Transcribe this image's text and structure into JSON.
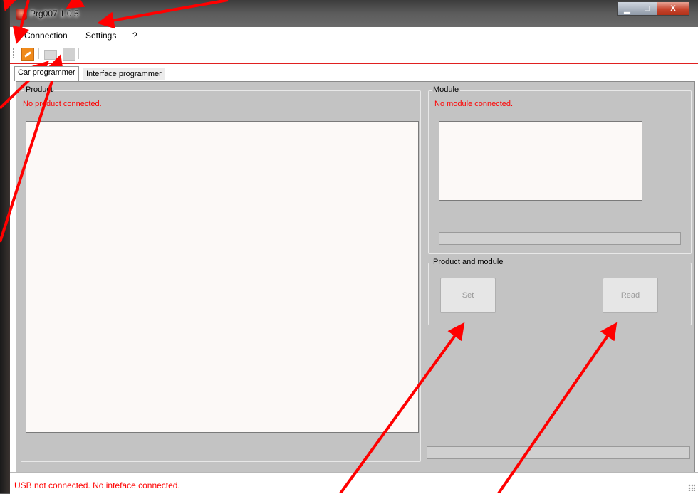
{
  "window": {
    "title": "Prg007  1.0.5",
    "controls": {
      "minimize": "▁",
      "maximize": "□",
      "close": "X"
    }
  },
  "menubar": {
    "items": [
      {
        "label": "Connection"
      },
      {
        "label": "Settings"
      },
      {
        "label": "?"
      }
    ]
  },
  "toolbar": {
    "buttons": [
      {
        "icon": "connect-icon",
        "enabled": true
      },
      {
        "icon": "open-folder-icon",
        "enabled": false
      },
      {
        "icon": "save-icon",
        "enabled": false
      }
    ]
  },
  "tabs": [
    {
      "label": "Car programmer",
      "active": true
    },
    {
      "label": "Interface programmer",
      "active": false
    }
  ],
  "product": {
    "group_label": "Product",
    "status": "No product connected."
  },
  "module": {
    "group_label": "Module",
    "status": "No module connected."
  },
  "product_and_module": {
    "group_label": "Product and module",
    "set_label": "Set",
    "read_label": "Read"
  },
  "statusbar": {
    "text": "USB not connected.  No inteface connected."
  },
  "colors": {
    "status_text": "#ff0000",
    "panel_bg": "#c3c3c3",
    "annotation_arrow": "#ff0000",
    "toolbar_connect": "#f08a1a"
  }
}
